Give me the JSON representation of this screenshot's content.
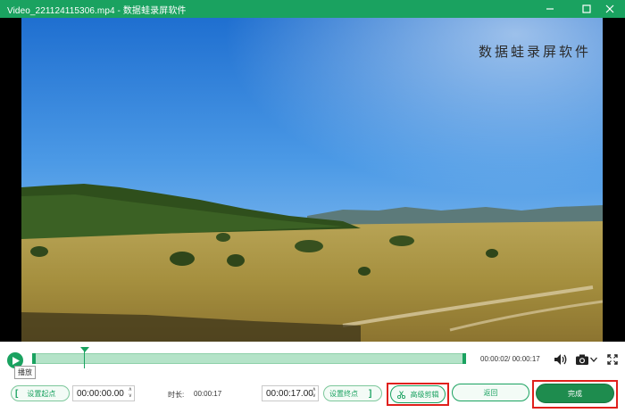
{
  "window": {
    "title": "Video_221124115306.mp4  -  数据蛙录屏软件",
    "accent_color": "#1aa260",
    "controls": [
      "minimize-icon",
      "maximize-icon",
      "close-icon"
    ]
  },
  "video": {
    "watermark": "数据蛙录屏软件",
    "scene": "grassland-landscape"
  },
  "player": {
    "play_tooltip": "播放",
    "time_current": "00:00:02",
    "time_total": "00:00:17",
    "time_display": "00:00:02/ 00:00:17",
    "playhead_progress": 0.12,
    "icons": [
      "play-icon",
      "volume-icon",
      "camera-icon",
      "chevron-down-icon",
      "fullscreen-icon"
    ]
  },
  "trim": {
    "set_start_label": "设置起点",
    "start_value": "00:00:00.00",
    "duration_label": "时长:",
    "duration_value": "00:00:17",
    "end_value": "00:00:17.00",
    "set_end_label": "设置终点",
    "bracket_open": "[",
    "bracket_close": "]"
  },
  "actions": {
    "advanced_cut_label": "高级剪辑",
    "back_label": "返回",
    "done_label": "完成"
  }
}
